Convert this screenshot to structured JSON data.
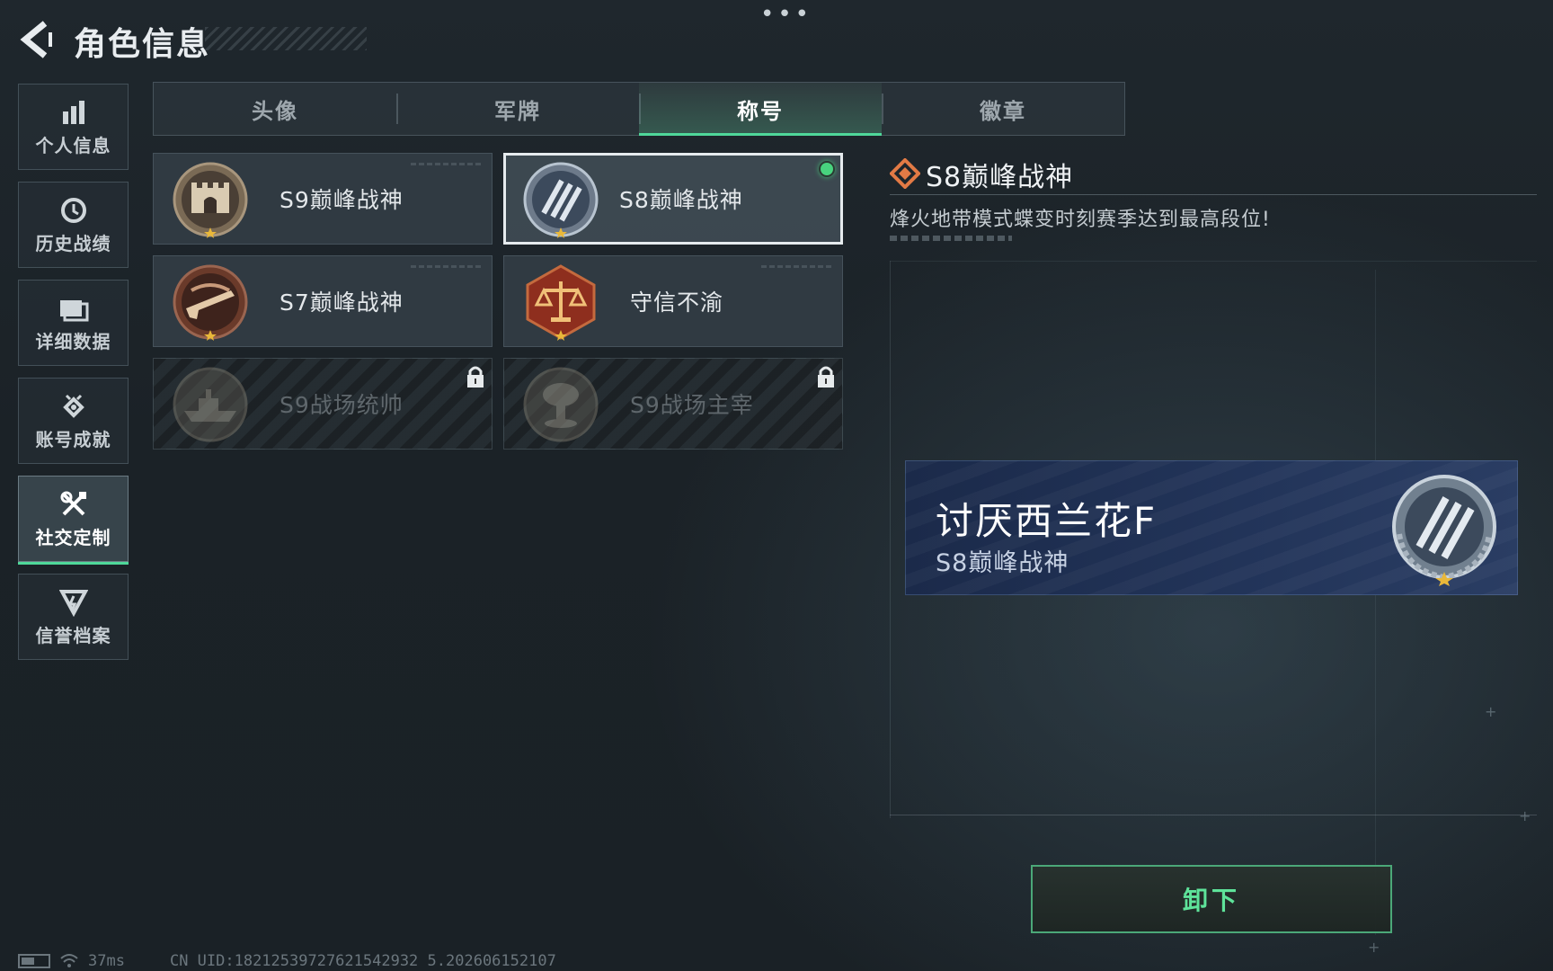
{
  "header": {
    "title": "角色信息",
    "more_label": "•••"
  },
  "sidebar": {
    "items": [
      {
        "label": "个人信息",
        "icon": "bar-chart-icon",
        "active": false
      },
      {
        "label": "历史战绩",
        "icon": "history-clock-icon",
        "active": false
      },
      {
        "label": "详细数据",
        "icon": "folder-icon",
        "active": false
      },
      {
        "label": "账号成就",
        "icon": "achievement-icon",
        "active": false
      },
      {
        "label": "社交定制",
        "icon": "tools-icon",
        "active": true
      },
      {
        "label": "信誉档案",
        "icon": "credit-shield-icon",
        "active": false
      }
    ]
  },
  "tabs": [
    {
      "label": "头像",
      "active": false
    },
    {
      "label": "军牌",
      "active": false
    },
    {
      "label": "称号",
      "active": true
    },
    {
      "label": "徽章",
      "active": false
    }
  ],
  "titles": [
    {
      "name": "S9巅峰战神",
      "emblem": "fortress-emblem-icon",
      "selected": false,
      "equipped": false,
      "locked": false
    },
    {
      "name": "S8巅峰战神",
      "emblem": "shield-stripes-emblem-icon",
      "selected": true,
      "equipped": true,
      "locked": false
    },
    {
      "name": "S7巅峰战神",
      "emblem": "rifle-emblem-icon",
      "selected": false,
      "equipped": false,
      "locked": false
    },
    {
      "name": "守信不渝",
      "emblem": "scales-emblem-icon",
      "selected": false,
      "equipped": false,
      "locked": false
    },
    {
      "name": "S9战场统帅",
      "emblem": "warship-emblem-icon",
      "selected": false,
      "equipped": false,
      "locked": true
    },
    {
      "name": "S9战场主宰",
      "emblem": "mushroom-cloud-emblem-icon",
      "selected": false,
      "equipped": false,
      "locked": true
    }
  ],
  "detail": {
    "title": "S8巅峰战神",
    "description": "烽火地带模式蝶变时刻赛季达到最高段位!",
    "icon": "diamond-rank-icon"
  },
  "nameplate": {
    "player_name": "讨厌西兰花F",
    "title": "S8巅峰战神"
  },
  "actions": {
    "unequip_label": "卸下"
  },
  "status_bar": {
    "ping": "37ms",
    "uid": "CN UID:18212539727621542932 5.202606152107"
  },
  "colors": {
    "accent_green": "#4fd89a",
    "equipped_dot": "#48d37e",
    "nameplate_blue": "#223459",
    "rank_orange": "#e27a45"
  }
}
